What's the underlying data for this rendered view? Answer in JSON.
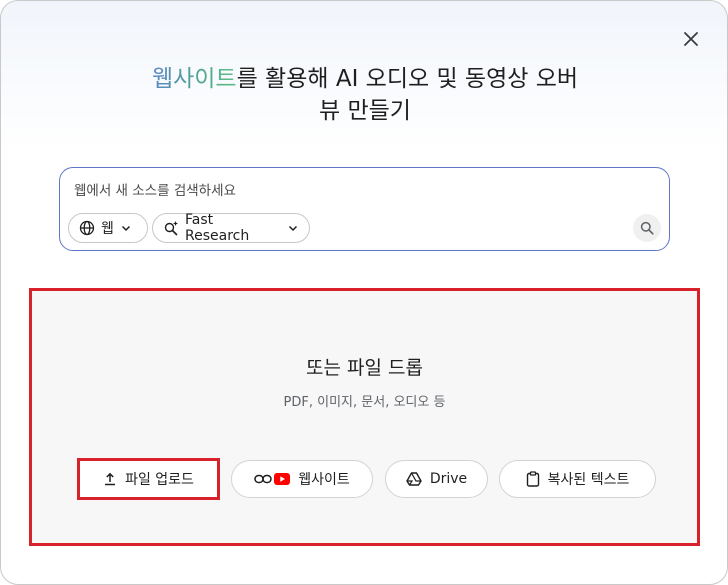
{
  "dialog": {
    "title_highlight": "웹사이트",
    "title_rest": "를 활용해 AI 오디오 및 동영상 오버",
    "title_line2": "뷰 만들기"
  },
  "search": {
    "placeholder": "웹에서 새 소스를 검색하세요",
    "source_chip": "웹",
    "mode_chip": "Fast Research"
  },
  "drop": {
    "title": "또는 파일 드롭",
    "subtitle": "PDF, 이미지, 문서, 오디오 등"
  },
  "actions": {
    "upload": "파일 업로드",
    "website": "웹사이트",
    "drive": "Drive",
    "copied_text": "복사된 텍스트"
  },
  "colors": {
    "accent_border": "#5e78c8",
    "highlight_red": "#d7222b",
    "youtube_red": "#ff0000"
  }
}
